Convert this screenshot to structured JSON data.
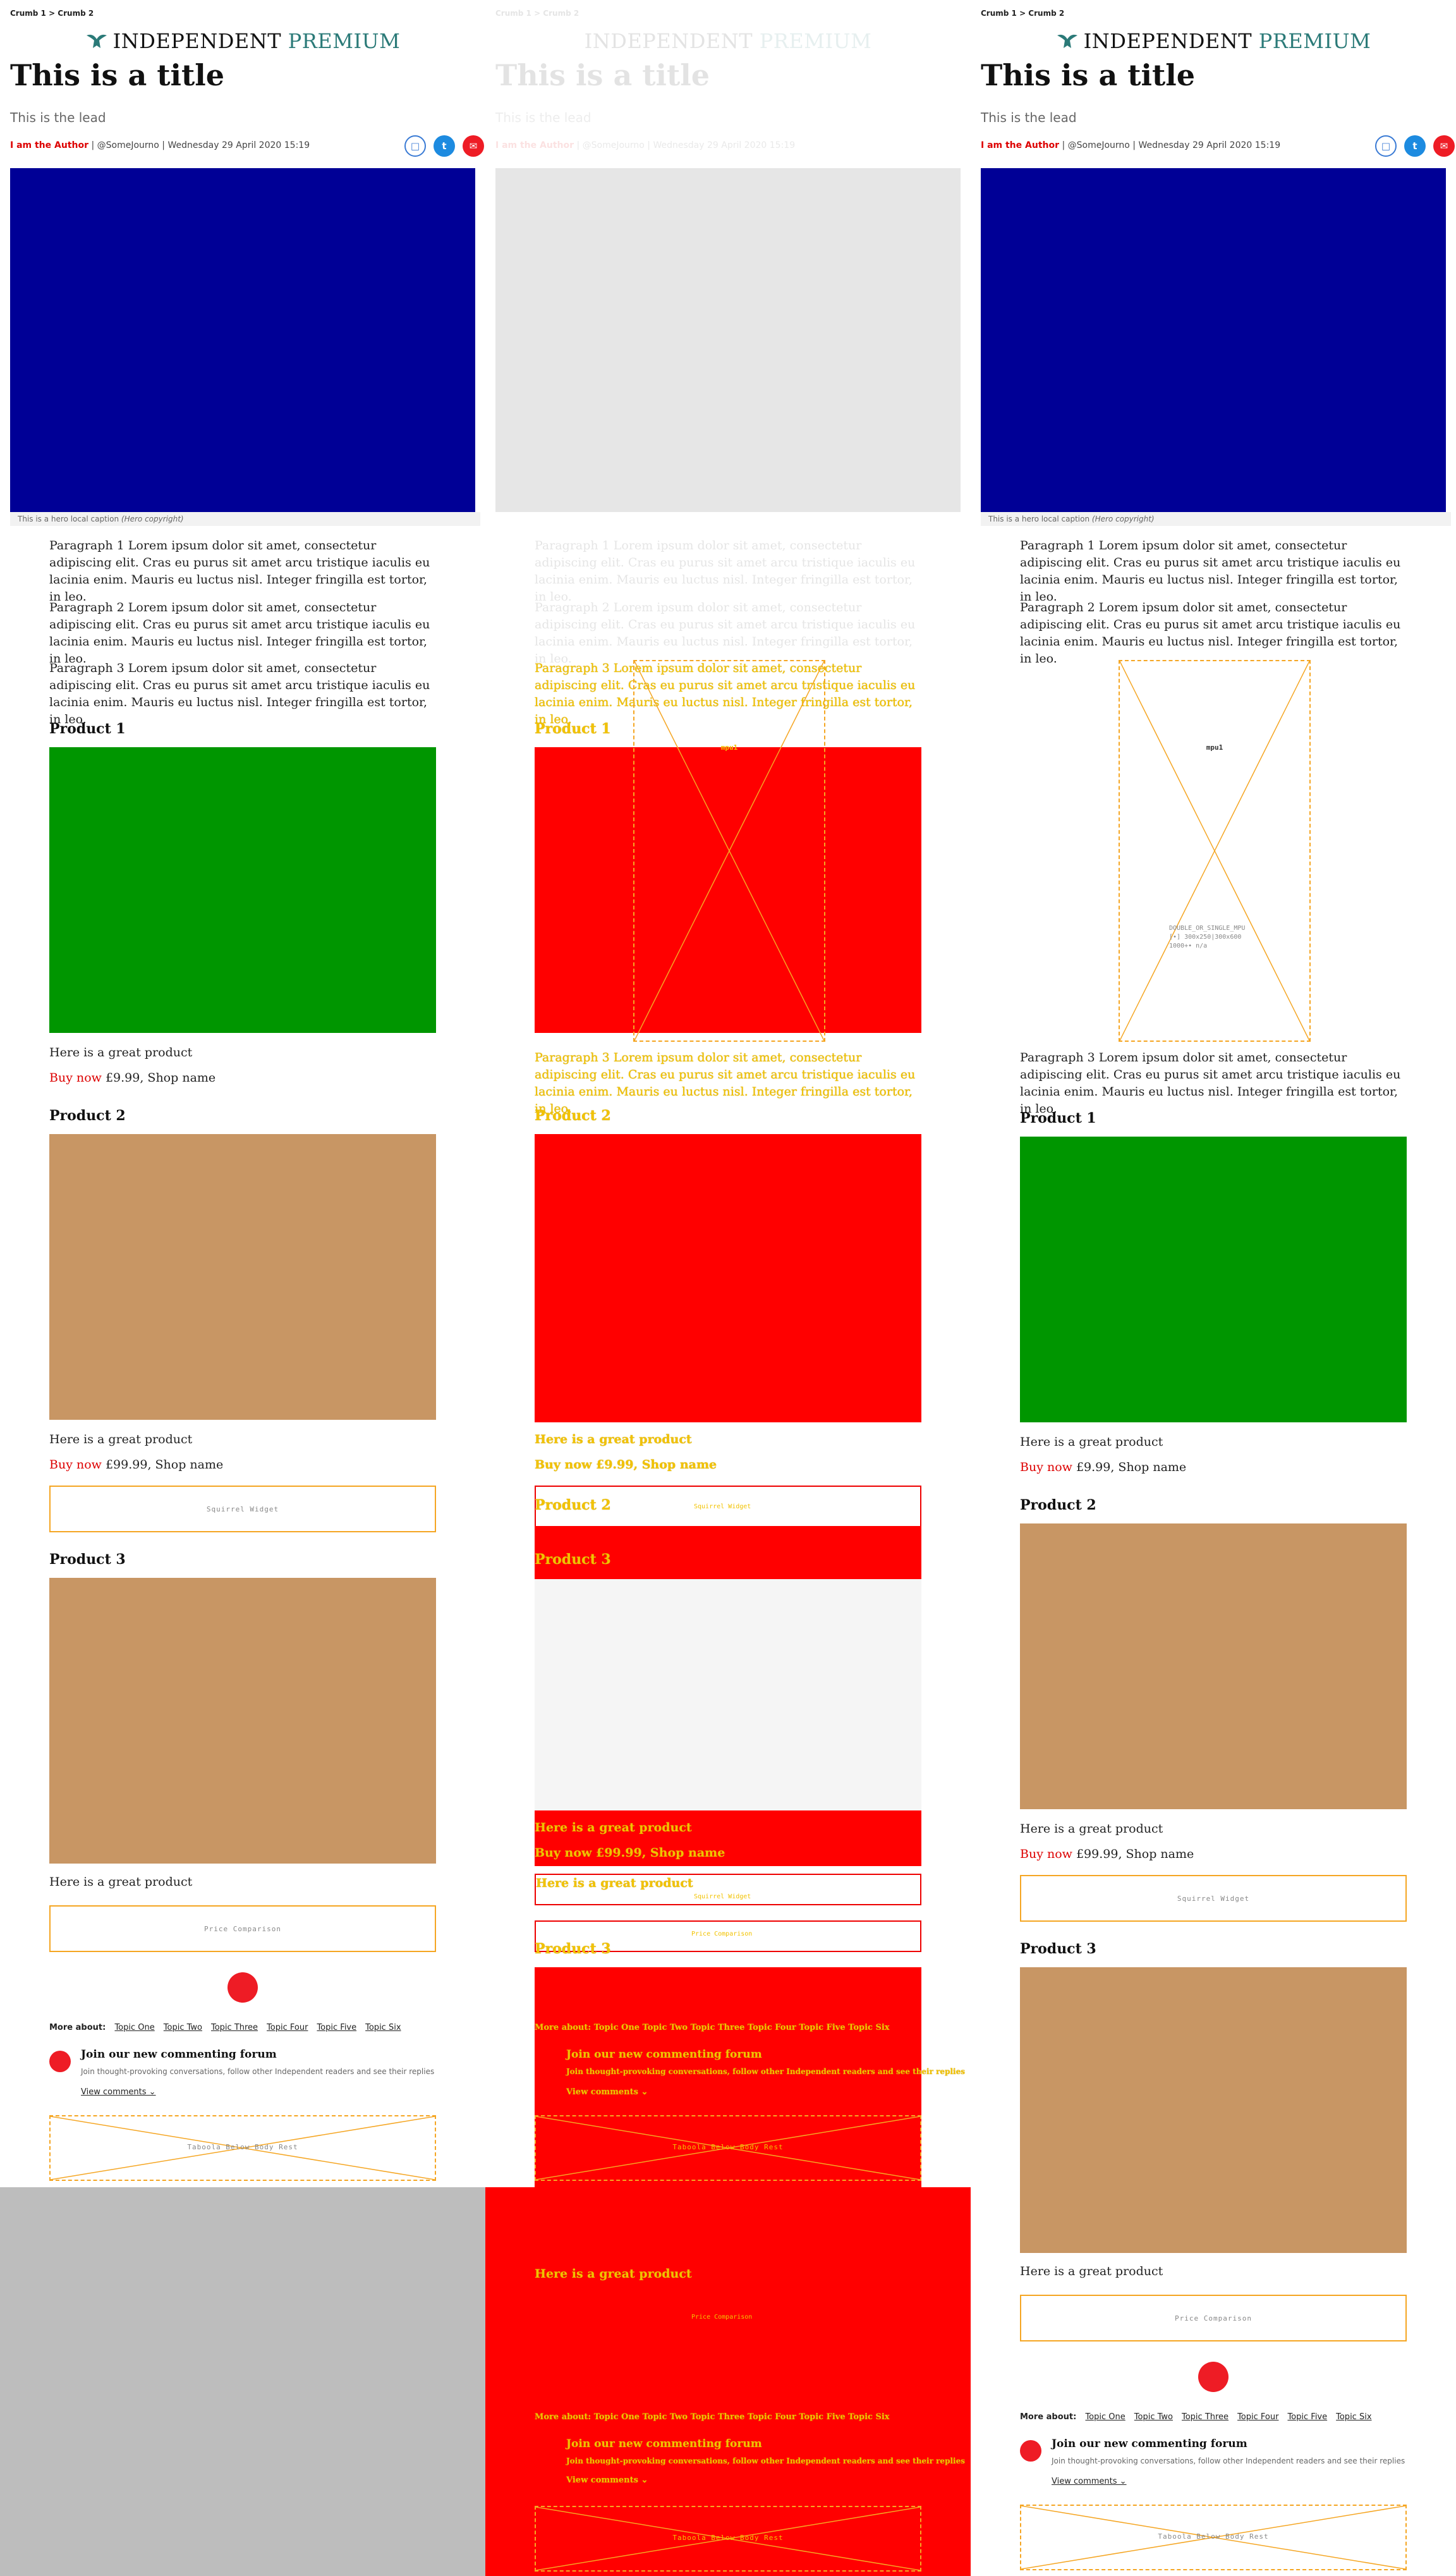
{
  "breadcrumb": "Crumb 1 > Crumb 2",
  "logo": {
    "brand": "INDEPENDENT",
    "tier": "PREMIUM"
  },
  "article": {
    "title": "This is a title",
    "lead": "This is the lead",
    "author": "I am the Author",
    "byline_rest": " | @SomeJourno | Wednesday 29 April 2020 15:19",
    "hero_caption": "This is a hero local caption",
    "hero_copyright": "(Hero copyright)",
    "paragraphs": [
      "Paragraph 1 Lorem ipsum dolor sit amet, consectetur adipiscing elit. Cras eu purus sit amet arcu tristique iaculis eu lacinia enim. Mauris eu luctus nisl. Integer fringilla est tortor, in leo.",
      "Paragraph 2 Lorem ipsum dolor sit amet, consectetur adipiscing elit. Cras eu purus sit amet arcu tristique iaculis eu lacinia enim. Mauris eu luctus nisl. Integer fringilla est tortor, in leo.",
      "Paragraph 3 Lorem ipsum dolor sit amet, consectetur adipiscing elit. Cras eu purus sit amet arcu tristique iaculis eu lacinia enim. Mauris eu luctus nisl. Integer fringilla est tortor, in leo."
    ]
  },
  "products": [
    {
      "heading": "Product 1",
      "desc": "Here is a great product",
      "buy": "Buy now",
      "price": " £9.99, Shop name"
    },
    {
      "heading": "Product 2",
      "desc": "Here is a great product",
      "buy": "Buy now",
      "price": " £99.99, Shop name"
    },
    {
      "heading": "Product 3",
      "desc": "Here is a great product"
    }
  ],
  "widgets": {
    "squirrel": "Squirrel Widget",
    "price_comparison": "Price Comparison",
    "taboola": "Taboola Below Body Rest"
  },
  "mpu": {
    "label": "mpu1",
    "meta": "DOUBLE_OR_SINGLE_MPU\n[•] 300x250|300x600\n1000+• n/a"
  },
  "more_about": {
    "label": "More about:",
    "topics": [
      "Topic One",
      "Topic Two",
      "Topic Three",
      "Topic Four",
      "Topic Five",
      "Topic Six"
    ]
  },
  "comments": {
    "title": "Join our new commenting forum",
    "subtitle": "Join thought-provoking conversations, follow other Independent readers and see their replies",
    "view": "View comments ⌄"
  },
  "colors": {
    "hero": "#000096",
    "product1": "#009600",
    "product2": "#c89664",
    "accent_red": "#ee1c25",
    "ad_border": "#f5a623",
    "overlay_red": "#ff0000",
    "overlay_yellow": "#f2c200",
    "premium": "#2b7a78"
  },
  "icons": [
    "eagle-logo-icon",
    "bookmark-icon",
    "twitter-icon",
    "email-icon",
    "independent-badge-icon"
  ]
}
